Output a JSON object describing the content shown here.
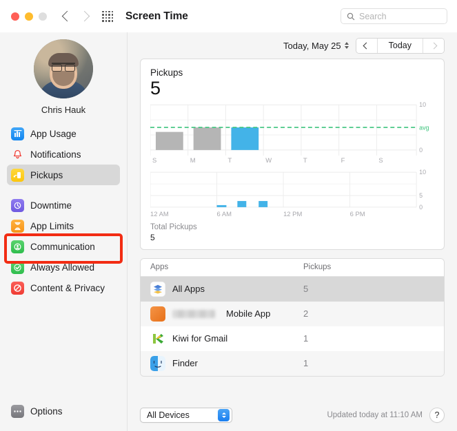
{
  "window": {
    "title": "Screen Time",
    "traffic_lights": [
      "close",
      "minimize",
      "zoom"
    ],
    "back_icon": "chevron-left-icon",
    "forward_icon": "chevron-right-icon",
    "grid_icon": "app-grid-icon"
  },
  "search": {
    "placeholder": "Search",
    "value": "",
    "icon": "search-icon"
  },
  "sidebar": {
    "profile": {
      "name": "Chris Hauk",
      "avatar": "user-avatar"
    },
    "items": [
      {
        "label": "App Usage",
        "icon": "app-usage-icon",
        "color": "#1186f0",
        "selected": false
      },
      {
        "label": "Notifications",
        "icon": "notifications-icon",
        "color": "#ef3b33",
        "selected": false
      },
      {
        "label": "Pickups",
        "icon": "pickups-icon",
        "color": "#fcc60d",
        "selected": true
      },
      {
        "label": "Downtime",
        "icon": "downtime-icon",
        "color": "#6f5ae0",
        "selected": false
      },
      {
        "label": "App Limits",
        "icon": "app-limits-icon",
        "color": "#f79317",
        "selected": false
      },
      {
        "label": "Communication",
        "icon": "communication-icon",
        "color": "#2fbd4d",
        "selected": false
      },
      {
        "label": "Always Allowed",
        "icon": "always-allowed-icon",
        "color": "#2fbd4d",
        "selected": false
      },
      {
        "label": "Content & Privacy",
        "icon": "content-privacy-icon",
        "color": "#ef3b33",
        "selected": false
      }
    ],
    "options": {
      "label": "Options",
      "icon": "options-icon",
      "color": "#77777c"
    },
    "highlight_color": "#f22c13"
  },
  "datebar": {
    "date_label": "Today, May 25",
    "stepper_icon": "stepper-icon",
    "prev_icon": "chevron-left-icon",
    "today_label": "Today",
    "next_icon": "chevron-right-icon",
    "next_disabled": true
  },
  "chart_card": {
    "title": "Pickups",
    "value": "5",
    "total_label": "Total Pickups",
    "total_value": "5"
  },
  "apps_card": {
    "columns": [
      "Apps",
      "Pickups"
    ],
    "rows": [
      {
        "name": "All Apps",
        "pickups": "5",
        "icon": "all-apps-icon",
        "selected": true,
        "redacted": false
      },
      {
        "name": "Mobile App",
        "pickups": "2",
        "icon": "mobile-app-icon",
        "selected": false,
        "redacted": true
      },
      {
        "name": "Kiwi for Gmail",
        "pickups": "1",
        "icon": "kiwi-icon",
        "selected": false,
        "redacted": false
      },
      {
        "name": "Finder",
        "pickups": "1",
        "icon": "finder-icon",
        "selected": false,
        "redacted": false
      }
    ]
  },
  "footer": {
    "device_filter": "All Devices",
    "updated": "Updated today at 11:10 AM",
    "help_label": "?"
  },
  "chart_data": [
    {
      "type": "bar",
      "id": "weekly-pickups",
      "title": "Pickups",
      "categories": [
        "S",
        "M",
        "T",
        "W",
        "T",
        "F",
        "S"
      ],
      "values": [
        4,
        5.5,
        5,
        0,
        0,
        0,
        0
      ],
      "highlight_index": 2,
      "highlight_color": "#43b3e8",
      "bar_color": "#b3b3b3",
      "average_line": {
        "value": 5,
        "label": "avg",
        "color": "#3cc47c",
        "style": "dashed"
      },
      "ylim": [
        0,
        10
      ],
      "yticks": [
        0,
        10
      ],
      "ytick_labels": [
        "0",
        "10"
      ],
      "xlabel": "",
      "ylabel": "",
      "grid": true
    },
    {
      "type": "bar",
      "id": "hourly-pickups",
      "title": "",
      "x": [
        "12 AM",
        "6 AM",
        "12 PM",
        "6 PM"
      ],
      "xtick_labels": [
        "12 AM",
        "6 AM",
        "12 PM",
        "6 PM"
      ],
      "bars": [
        {
          "hour": 6,
          "value": 0.4
        },
        {
          "hour": 8,
          "value": 1
        },
        {
          "hour": 10,
          "value": 1
        }
      ],
      "bar_color": "#43b3e8",
      "ylim": [
        0,
        10
      ],
      "yticks": [
        0,
        5,
        10
      ],
      "ytick_labels": [
        "0",
        "5",
        "10"
      ],
      "grid": true
    }
  ]
}
